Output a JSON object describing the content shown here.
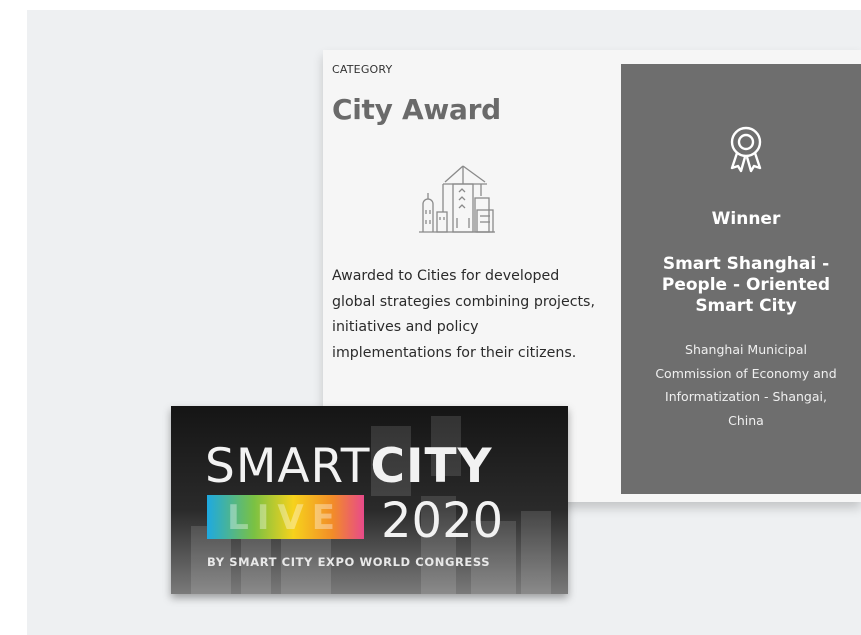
{
  "category": {
    "label": "CATEGORY",
    "title": "City Award",
    "icon": "city-buildings-icon",
    "description": "Awarded to Cities for developed global strategies combining projects, initiatives and policy implementations for their citizens."
  },
  "winner": {
    "icon": "award-ribbon-icon",
    "label": "Winner",
    "project": "Smart Shanghai - People - Oriented Smart City",
    "organization": "Shanghai Municipal Commission of Economy and Informatization - Shangai, China"
  },
  "logo": {
    "word_smart": "SMART",
    "word_city": "CITY",
    "word_live": "LIVE",
    "year": "2020",
    "tagline": "BY SMART CITY EXPO WORLD CONGRESS"
  },
  "colors": {
    "background": "#eef0f2",
    "card": "#f6f6f6",
    "winner_panel": "#6e6e6e",
    "title_text": "#6a6a6a"
  }
}
